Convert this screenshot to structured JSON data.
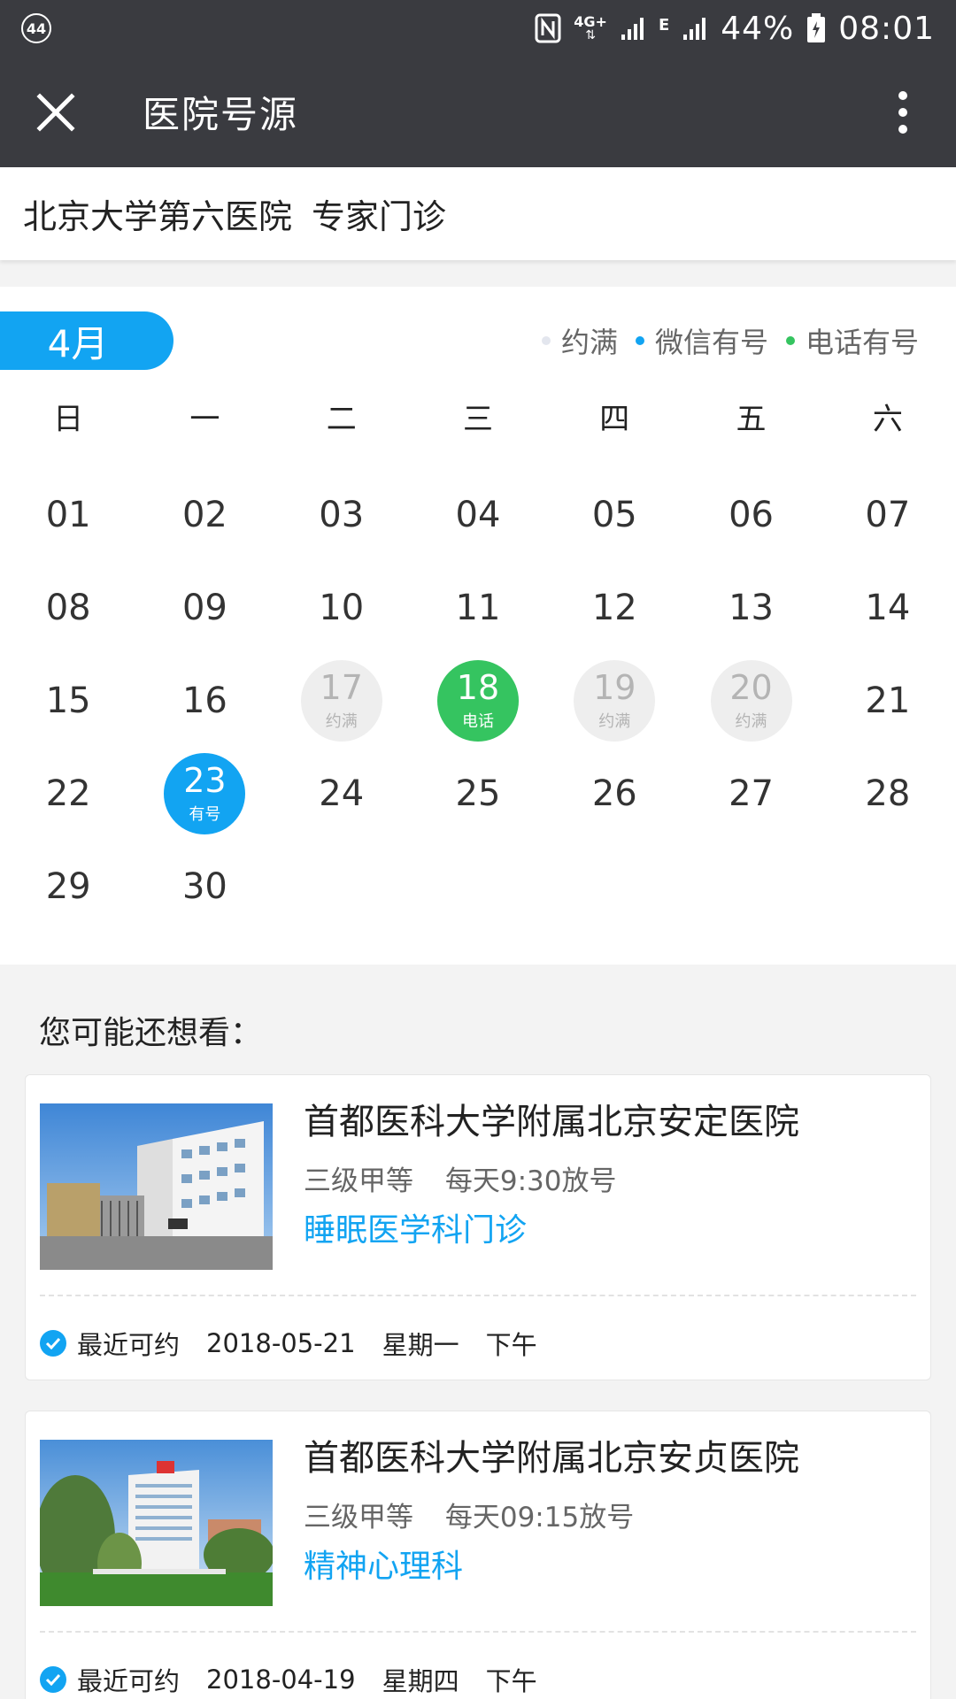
{
  "status_bar": {
    "notification_count": "44",
    "network_1": "4G+",
    "network_2": "E",
    "battery": "44%",
    "time": "08:01"
  },
  "app_bar": {
    "title": "医院号源",
    "close_icon": "close-icon",
    "more_icon": "more-vertical-icon"
  },
  "hospital": {
    "name": "北京大学第六医院",
    "type": "专家门诊"
  },
  "calendar": {
    "month": "4月",
    "legend": [
      {
        "label": "约满",
        "color": "#e3e6ee"
      },
      {
        "label": "微信有号",
        "color": "#12a4f2"
      },
      {
        "label": "电话有号",
        "color": "#35c460"
      }
    ],
    "weekdays": [
      "日",
      "一",
      "二",
      "三",
      "四",
      "五",
      "六"
    ],
    "days": [
      {
        "num": "01"
      },
      {
        "num": "02"
      },
      {
        "num": "03"
      },
      {
        "num": "04"
      },
      {
        "num": "05"
      },
      {
        "num": "06"
      },
      {
        "num": "07"
      },
      {
        "num": "08"
      },
      {
        "num": "09"
      },
      {
        "num": "10"
      },
      {
        "num": "11"
      },
      {
        "num": "12"
      },
      {
        "num": "13"
      },
      {
        "num": "14"
      },
      {
        "num": "15"
      },
      {
        "num": "16"
      },
      {
        "num": "17",
        "status": "full",
        "label": "约满"
      },
      {
        "num": "18",
        "status": "phone",
        "label": "电话"
      },
      {
        "num": "19",
        "status": "full",
        "label": "约满"
      },
      {
        "num": "20",
        "status": "full",
        "label": "约满"
      },
      {
        "num": "21"
      },
      {
        "num": "22"
      },
      {
        "num": "23",
        "status": "wechat",
        "label": "有号"
      },
      {
        "num": "24"
      },
      {
        "num": "25"
      },
      {
        "num": "26"
      },
      {
        "num": "27"
      },
      {
        "num": "28"
      },
      {
        "num": "29"
      },
      {
        "num": "30"
      }
    ]
  },
  "recommend": {
    "title": "您可能还想看：",
    "cards": [
      {
        "name": "首都医科大学附属北京安定医院",
        "level": "三级甲等",
        "release": "每天9:30放号",
        "department": "睡眠医学科门诊",
        "recent_label": "最近可约",
        "date": "2018-05-21",
        "weekday": "星期一",
        "period": "下午"
      },
      {
        "name": "首都医科大学附属北京安贞医院",
        "level": "三级甲等",
        "release": "每天09:15放号",
        "department": "精神心理科",
        "recent_label": "最近可约",
        "date": "2018-04-19",
        "weekday": "星期四",
        "period": "下午"
      }
    ]
  }
}
